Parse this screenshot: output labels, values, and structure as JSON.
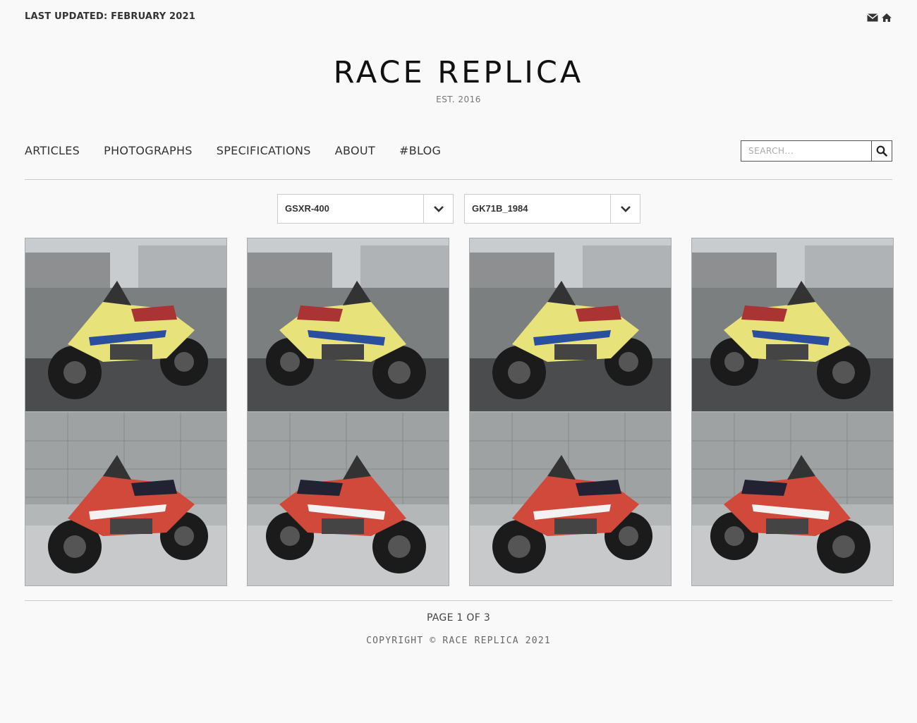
{
  "header": {
    "last_updated": "LAST UPDATED: FEBRUARY 2021",
    "icons": [
      "envelope-icon",
      "home-icon"
    ]
  },
  "logo": {
    "title": "RACE REPLICA",
    "est": "EST. 2016"
  },
  "nav": {
    "items": [
      {
        "label": "ARTICLES"
      },
      {
        "label": "PHOTOGRAPHS"
      },
      {
        "label": "SPECIFICATIONS"
      },
      {
        "label": "ABOUT"
      },
      {
        "label": "#BLOG"
      }
    ]
  },
  "search": {
    "placeholder": "SEARCH..."
  },
  "filters": {
    "model": {
      "selected": "GSXR-400"
    },
    "variant": {
      "selected": "GK71B_1984"
    }
  },
  "gallery": {
    "photos": [
      {
        "alt": "Yellow Suzuki GSX-R 400 parked beside covered bikes",
        "livery": "yellow"
      },
      {
        "alt": "Yellow Suzuki GSX-R 400 side view",
        "livery": "yellow"
      },
      {
        "alt": "Yellow Suzuki GSX-R 400 front three-quarter",
        "livery": "yellow"
      },
      {
        "alt": "Yellow Suzuki GSX-R 400 with classic car",
        "livery": "yellow"
      },
      {
        "alt": "Red and black Suzuki GSX-R 400 front left",
        "livery": "red"
      },
      {
        "alt": "Red and black Suzuki GSX-R 400 front right",
        "livery": "red"
      },
      {
        "alt": "Red and black Suzuki GSX-R 400 left profile",
        "livery": "red"
      },
      {
        "alt": "Red and black Suzuki GSX-R 400 right profile",
        "livery": "red"
      }
    ]
  },
  "footer": {
    "page": "PAGE 1 OF 3",
    "copyright": "COPYRIGHT © RACE REPLICA 2021"
  },
  "colors": {
    "background": "#f9f9f9",
    "text": "#333333",
    "rule": "#cccccc",
    "yellow_livery": "#e8e27a",
    "red_livery": "#d1493a"
  }
}
